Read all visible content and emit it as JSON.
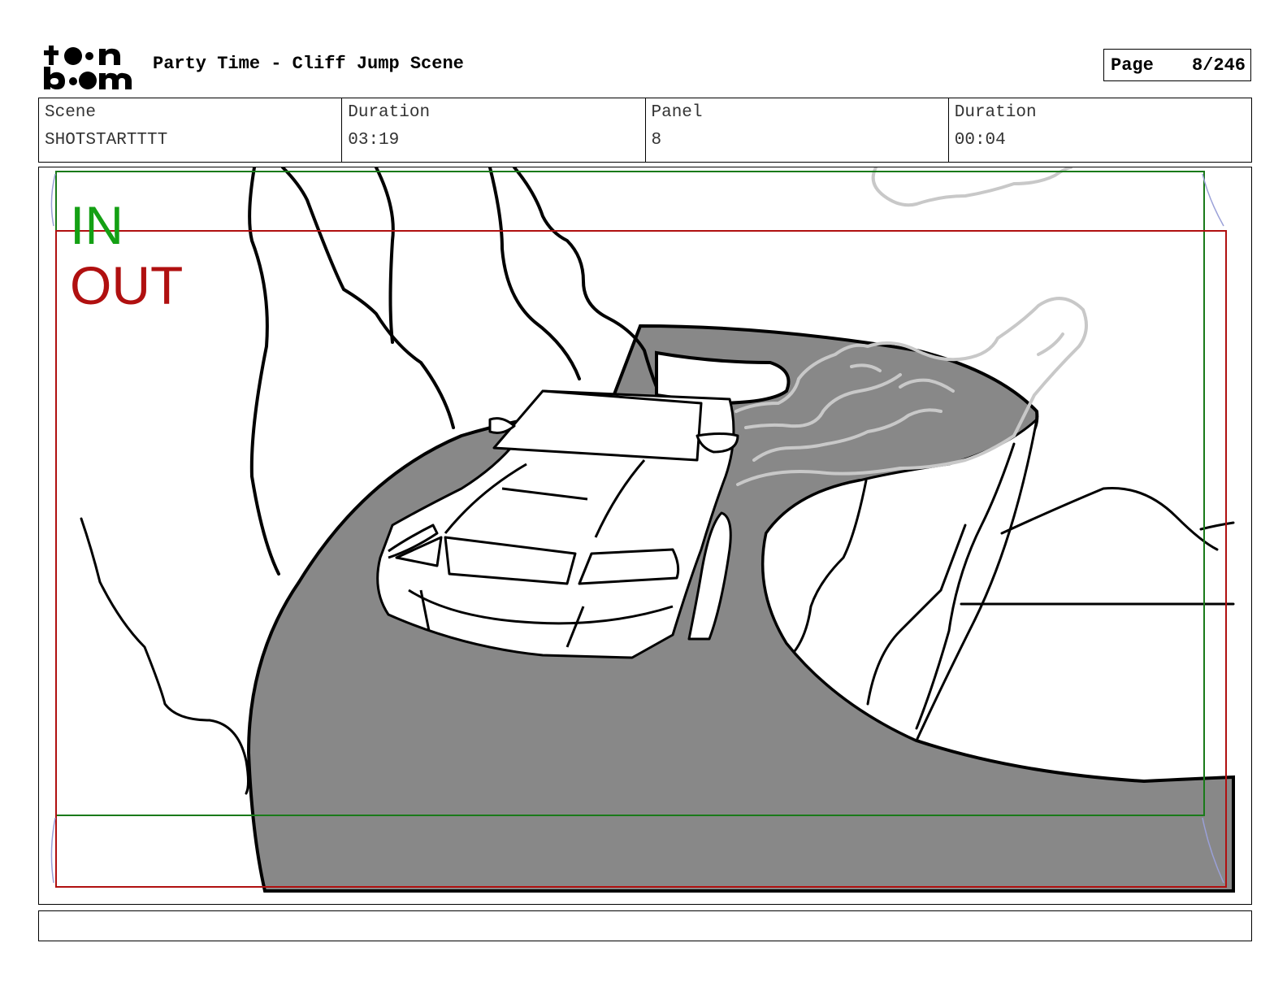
{
  "header": {
    "title": "Party Time - Cliff Jump Scene",
    "page_label": "Page",
    "page_value": "8/246"
  },
  "info": {
    "scene_label": "Scene",
    "scene_value": "SHOTSTARTTTT",
    "scene_duration_label": "Duration",
    "scene_duration_value": "03:19",
    "panel_label": "Panel",
    "panel_value": "8",
    "panel_duration_label": "Duration",
    "panel_duration_value": "00:04"
  },
  "panel": {
    "in_label": "IN",
    "out_label": "OUT",
    "colors": {
      "in_frame": "#1a7a1a",
      "out_frame": "#b01010",
      "road": "#888888",
      "smoke": "#c8c8c8"
    }
  },
  "caption": {
    "text": ""
  }
}
